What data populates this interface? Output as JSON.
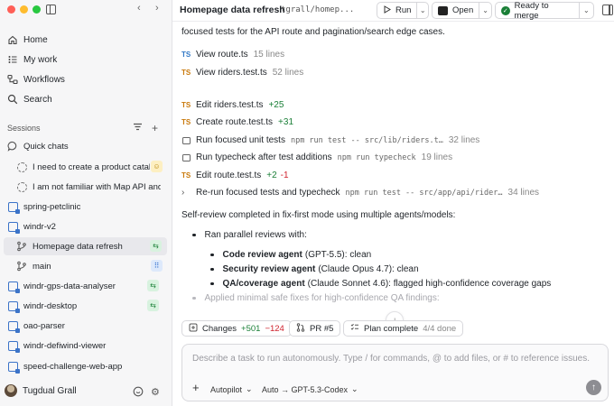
{
  "sidebar": {
    "nav": [
      {
        "label": "Home",
        "icon": "home-icon"
      },
      {
        "label": "My work",
        "icon": "list-icon"
      },
      {
        "label": "Workflows",
        "icon": "workflow-icon"
      },
      {
        "label": "Search",
        "icon": "search-icon"
      }
    ],
    "sessions_label": "Sessions",
    "quick_chats_label": "Quick chats",
    "quick_chats": [
      {
        "label": "I need to create a product catalo",
        "badge": "yellow"
      },
      {
        "label": "I am not familiar with Map API and t",
        "badge": ""
      }
    ],
    "repos": [
      {
        "label": "spring-petclinic"
      },
      {
        "label": "windr-v2"
      }
    ],
    "windr_children": [
      {
        "label": "Homepage data refresh",
        "selected": true,
        "badge": "green"
      },
      {
        "label": "main",
        "badge": "blue"
      }
    ],
    "more_repos": [
      {
        "label": "windr-gps-data-analyser",
        "badge": "green"
      },
      {
        "label": "windr-desktop",
        "badge": "green"
      },
      {
        "label": "oao-parser",
        "badge": ""
      },
      {
        "label": "windr-defiwind-viewer",
        "badge": ""
      },
      {
        "label": "speed-challenge-web-app",
        "badge": ""
      }
    ],
    "user_name": "Tugdual Grall"
  },
  "header": {
    "title": "Homepage data refresh",
    "branch": "tgrall/homep...",
    "run_label": "Run",
    "open_label": "Open",
    "merge_label": "Ready to merge"
  },
  "main": {
    "intro": "focused tests for the API route and pagination/search edge cases.",
    "views": [
      {
        "tag": "TS",
        "label": "View route.ts",
        "meta": "15 lines"
      },
      {
        "tag": "TS",
        "label": "View riders.test.ts",
        "meta": "52 lines"
      }
    ],
    "actions": [
      {
        "kind": "ts",
        "label": "Edit riders.test.ts",
        "plus": "+25",
        "minus": "",
        "code": "",
        "meta": ""
      },
      {
        "kind": "ts",
        "label": "Create route.test.ts",
        "plus": "+31",
        "minus": "",
        "code": "",
        "meta": ""
      },
      {
        "kind": "cmd",
        "label": "Run focused unit tests",
        "plus": "",
        "minus": "",
        "code": "npm run test -- src/lib/riders.t…",
        "meta": "32 lines"
      },
      {
        "kind": "cmd",
        "label": "Run typecheck after test additions",
        "plus": "",
        "minus": "",
        "code": "npm run typecheck",
        "meta": "19 lines"
      },
      {
        "kind": "ts",
        "label": "Edit route.test.ts",
        "plus": "+2",
        "minus": "-1",
        "code": "",
        "meta": ""
      },
      {
        "kind": "chev",
        "label": "Re-run focused tests and typecheck",
        "plus": "",
        "minus": "",
        "code": "npm run test -- src/app/api/rider…",
        "meta": "34 lines"
      }
    ],
    "review_summary": "Self-review completed in fix-first mode using multiple agents/models:",
    "parallel_label": "Ran parallel reviews with:",
    "reviews": [
      {
        "agent": "Code review agent",
        "detail": "(GPT-5.5): clean"
      },
      {
        "agent": "Security review agent",
        "detail": "(Claude Opus 4.7): clean"
      },
      {
        "agent": "QA/coverage agent",
        "detail": "(Claude Sonnet 4.6): flagged high-confidence coverage gaps"
      }
    ],
    "fixes_line": "Applied minimal safe fixes for high-confidence QA findings:"
  },
  "chips": {
    "changes_label": "Changes",
    "changes_plus": "+501",
    "changes_minus": "−124",
    "pr_label": "PR #5",
    "plan_label": "Plan complete",
    "plan_progress": "4/4 done"
  },
  "composer": {
    "placeholder": "Describe a task to run autonomously. Type / for commands, @ to add files, or # to reference issues...",
    "mode_label": "Autopilot",
    "model_label": "Auto → GPT-5.3-Codex"
  }
}
